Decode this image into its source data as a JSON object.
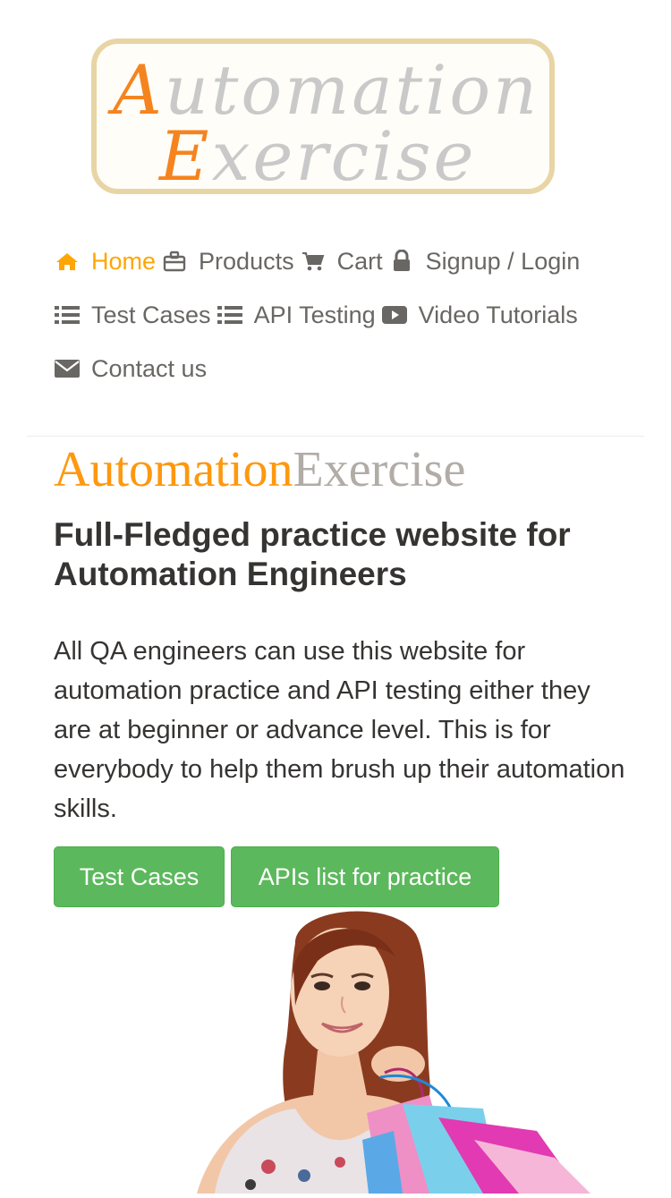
{
  "logo": {
    "line1_first": "A",
    "line1_rest": "utomation",
    "line2_first": "E",
    "line2_rest": "xercise"
  },
  "nav": {
    "home": "Home",
    "products": "Products",
    "cart": "Cart",
    "signup_login": "Signup / Login",
    "test_cases": "Test Cases",
    "api_testing": "API Testing",
    "video_tutorials": "Video Tutorials",
    "contact_us": "Contact us"
  },
  "hero": {
    "brand_part1": "Automation",
    "brand_part2": "Exercise",
    "headline": "Full-Fledged practice website for Automation Engineers",
    "description": "All QA engineers can use this website for automation practice and API testing either they are at beginner or advance level. This is for everybody to help them brush up their automation skills.",
    "btn_test_cases": "Test Cases",
    "btn_apis": "APIs list for practice"
  },
  "colors": {
    "accent_orange": "#fe980f",
    "button_green": "#5cb85c",
    "text_dark": "#363432",
    "nav_text": "#696763"
  }
}
